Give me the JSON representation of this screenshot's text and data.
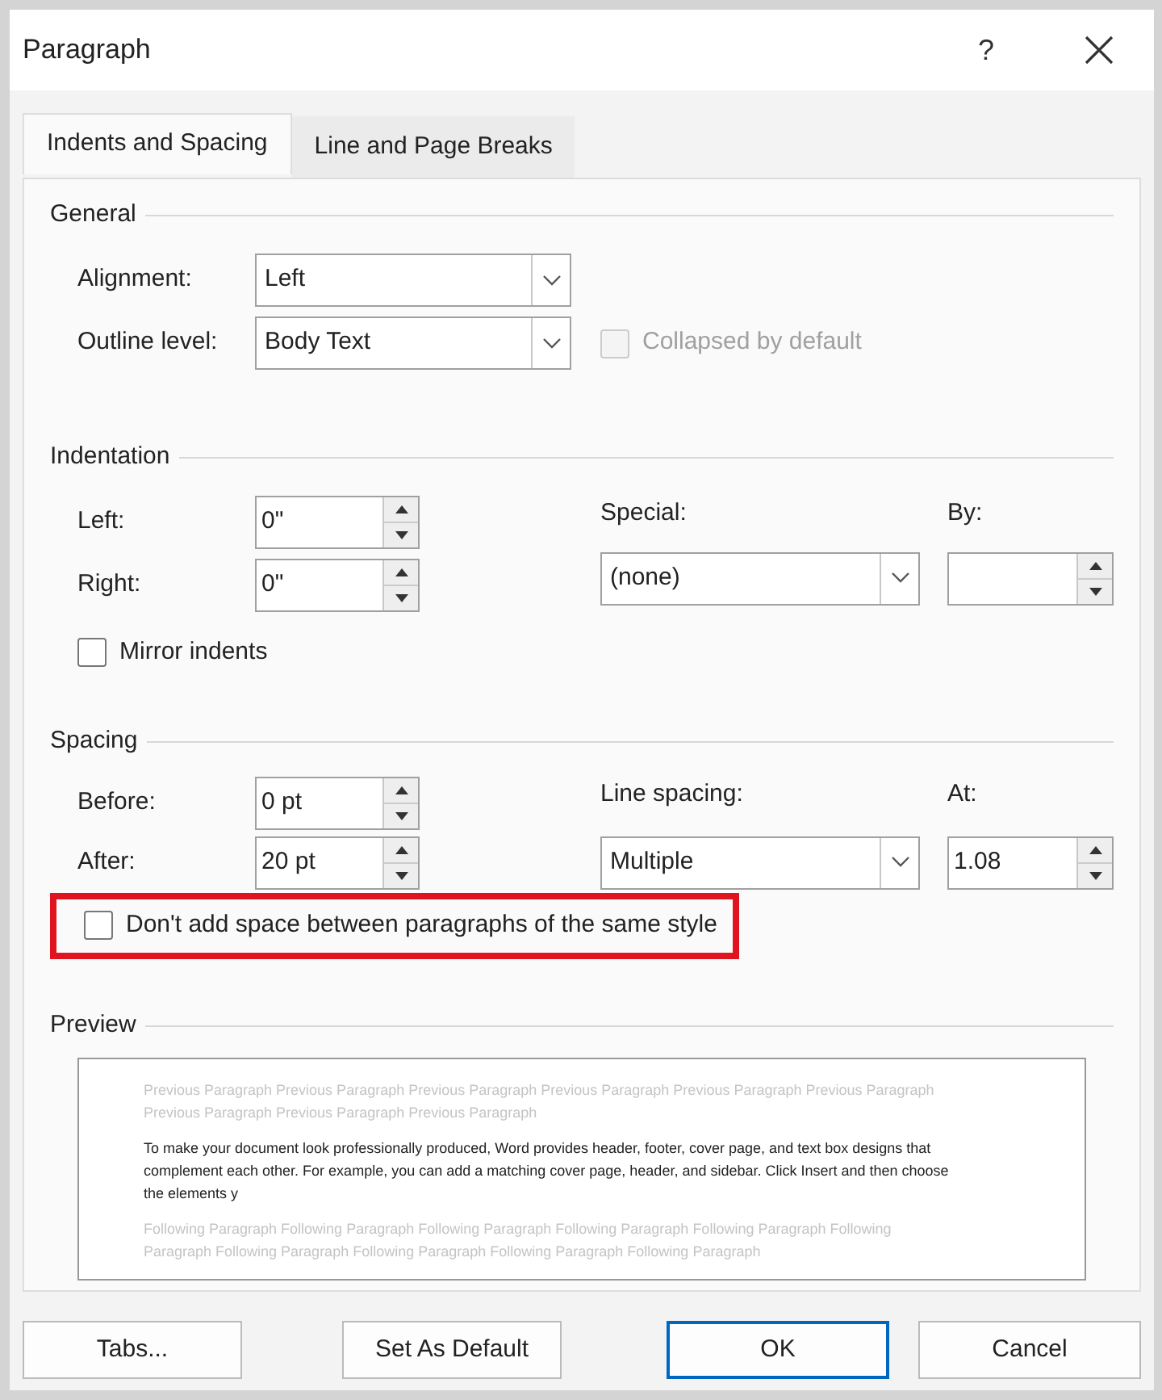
{
  "window": {
    "title": "Paragraph",
    "help": "?"
  },
  "tabs": [
    {
      "label": "Indents and Spacing",
      "selected": true
    },
    {
      "label": "Line and Page Breaks",
      "selected": false
    }
  ],
  "general": {
    "title": "General",
    "alignment": {
      "label": "Alignment:",
      "value": "Left"
    },
    "outline_level": {
      "label": "Outline level:",
      "value": "Body Text"
    },
    "collapsed": {
      "label": "Collapsed by default",
      "checked": false,
      "disabled": true
    }
  },
  "indentation": {
    "title": "Indentation",
    "left": {
      "label": "Left:",
      "value": "0\""
    },
    "right": {
      "label": "Right:",
      "value": "0\""
    },
    "special": {
      "label": "Special:",
      "value": "(none)"
    },
    "by": {
      "label": "By:"
    },
    "mirror": {
      "label": "Mirror indents",
      "checked": false,
      "disabled": false
    }
  },
  "spacing": {
    "title": "Spacing",
    "before": {
      "label": "Before:",
      "value": "0 pt"
    },
    "after": {
      "label": "After:",
      "value": "20 pt"
    },
    "line_spacing": {
      "label": "Line spacing:",
      "value": "Multiple"
    },
    "at": {
      "label": "At:",
      "value": "1.08"
    },
    "dont_add": {
      "label": "Don't add space between paragraphs of the same style",
      "checked": false,
      "disabled": false,
      "highlighted": true
    }
  },
  "preview": {
    "title": "Preview",
    "previous": "Previous Paragraph Previous Paragraph Previous Paragraph Previous Paragraph Previous Paragraph Previous Paragraph Previous Paragraph Previous Paragraph Previous Paragraph",
    "current": "To make your document look professionally produced, Word provides header, footer, cover page, and text box designs that complement each other. For example, you can add a matching cover page, header, and sidebar. Click Insert and then choose the elements y",
    "following": "Following Paragraph Following Paragraph Following Paragraph Following Paragraph Following Paragraph Following Paragraph Following Paragraph Following Paragraph Following Paragraph Following Paragraph"
  },
  "buttons": [
    {
      "label": "Tabs...",
      "default": false
    },
    {
      "label": "Set As Default",
      "default": false
    },
    {
      "label": "OK",
      "default": true
    },
    {
      "label": "Cancel",
      "default": false
    }
  ]
}
